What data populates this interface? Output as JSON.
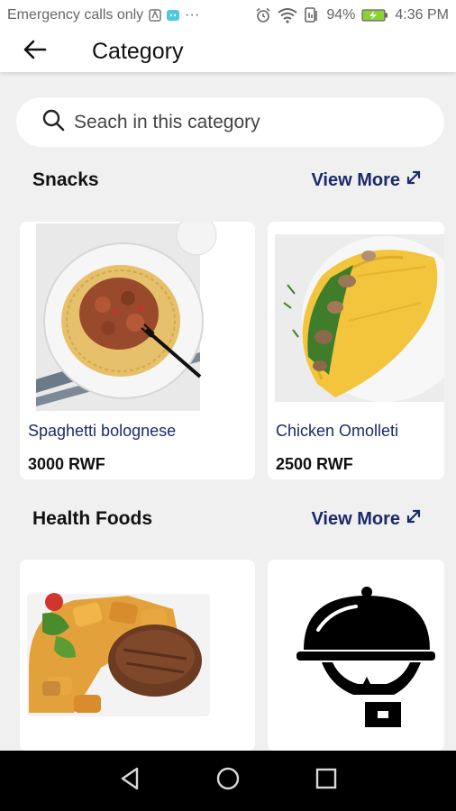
{
  "status_bar": {
    "carrier": "Emergency calls only",
    "dots": "···",
    "battery": "94%",
    "time": "4:36 PM"
  },
  "app_bar": {
    "title": "Category"
  },
  "search": {
    "placeholder": "Seach in this category"
  },
  "sections": [
    {
      "title": "Snacks",
      "view_more": "View More",
      "items": [
        {
          "name": "Spaghetti bolognese",
          "price": "3000 RWF"
        },
        {
          "name": "Chicken Omolleti",
          "price": "2500 RWF"
        }
      ]
    },
    {
      "title": "Health Foods",
      "view_more": "View More"
    }
  ],
  "colors": {
    "accent": "#1b2a6b",
    "background": "#f0f0f0"
  }
}
